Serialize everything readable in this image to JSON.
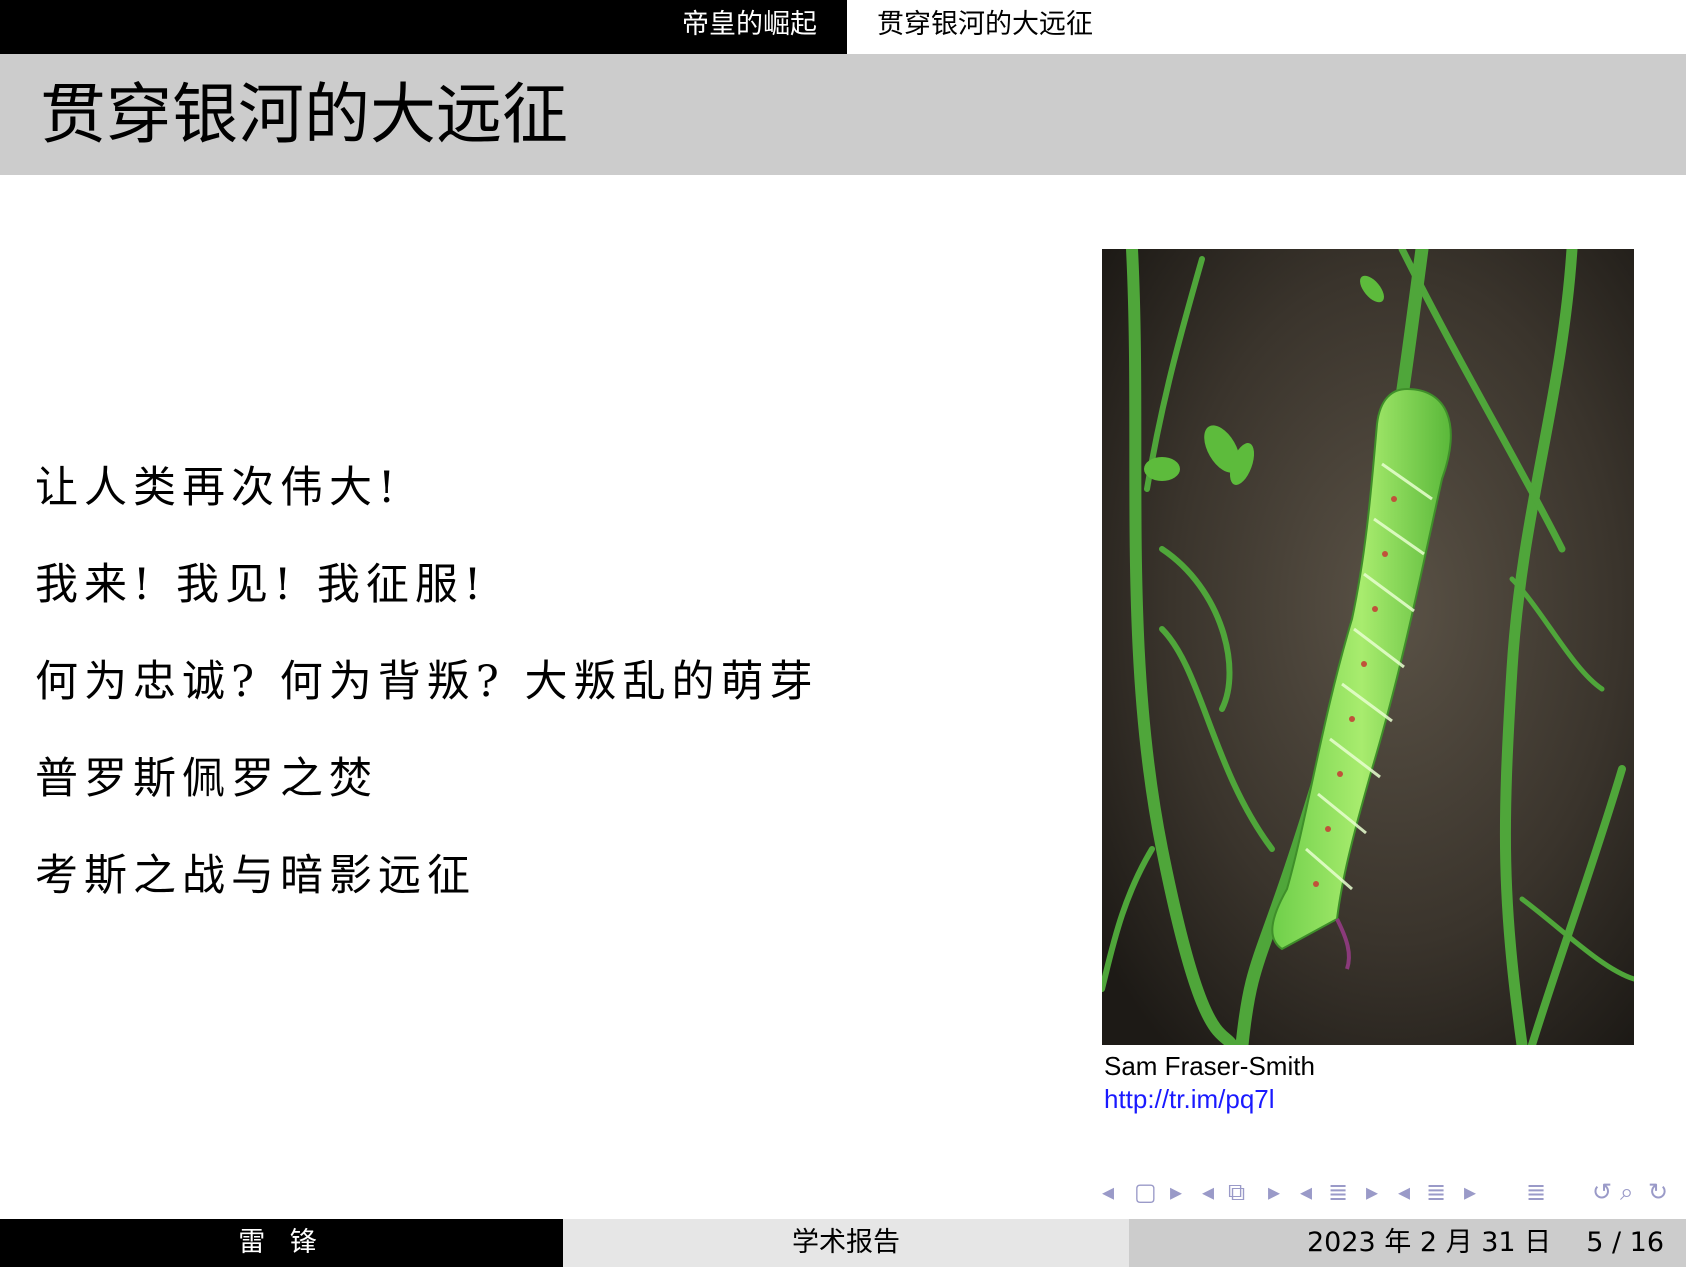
{
  "nav": {
    "section_active": "帝皇的崛起",
    "section_current": "贯穿银河的大远征"
  },
  "slide": {
    "title": "贯穿银河的大远征",
    "lines": [
      "让人类再次伟大!",
      "我来! 我见! 我征服!",
      "何为忠诚? 何为背叛? 大叛乱的萌芽",
      "普罗斯佩罗之焚",
      "考斯之战与暗影远征"
    ]
  },
  "image": {
    "subject": "green-caterpillar-photo",
    "author": "Sam Fraser-Smith",
    "link": "http://tr.im/pq7l"
  },
  "footer": {
    "author": "雷 锋",
    "title": "学术报告",
    "date": "2023 年 2 月 31 日",
    "page": "5 / 16"
  },
  "colors": {
    "bar_dark": "#000000",
    "title_band": "#cccccc",
    "footer_mid": "#e6e6e6",
    "link": "#1a1aff",
    "nav_symbols": "#9a9ac8"
  }
}
